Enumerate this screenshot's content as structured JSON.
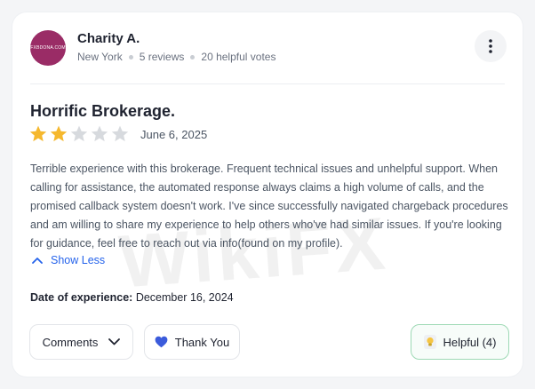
{
  "review": {
    "reviewer": {
      "name": "Charity A.",
      "avatar_text": "FXBDONA.COM",
      "location": "New York",
      "reviews_count": "5 reviews",
      "helpful_votes": "20 helpful votes"
    },
    "title": "Horrific Brokerage.",
    "rating": 2,
    "max_rating": 5,
    "date": "June 6, 2025",
    "body": "Terrible experience with this brokerage. Frequent technical issues and unhelpful support. When calling for assistance, the automated response always claims a high volume of calls, and the promised callback system doesn't work. I've since successfully navigated chargeback procedures and am willing to share my experience to help others who've had similar issues. If you're looking for guidance, feel free to reach out via info(found on my profile).",
    "show_less_label": "Show Less",
    "experience_label": "Date of experience:",
    "experience_date": "December 16, 2024"
  },
  "actions": {
    "comments_label": "Comments",
    "thank_you_label": "Thank You",
    "helpful_label": "Helpful (4)"
  },
  "watermark": "WikiFX",
  "colors": {
    "avatar_bg": "#9a2c66",
    "star_filled": "#f5b82e",
    "star_empty": "#d7dade",
    "link": "#2563eb",
    "helpful_border": "#9ed9b5"
  },
  "icons": {
    "menu": "more-vertical-icon",
    "show_less": "chevron-up-icon",
    "comments": "chevron-down-icon",
    "thank_you": "heart-icon",
    "helpful": "lightbulb-icon"
  }
}
